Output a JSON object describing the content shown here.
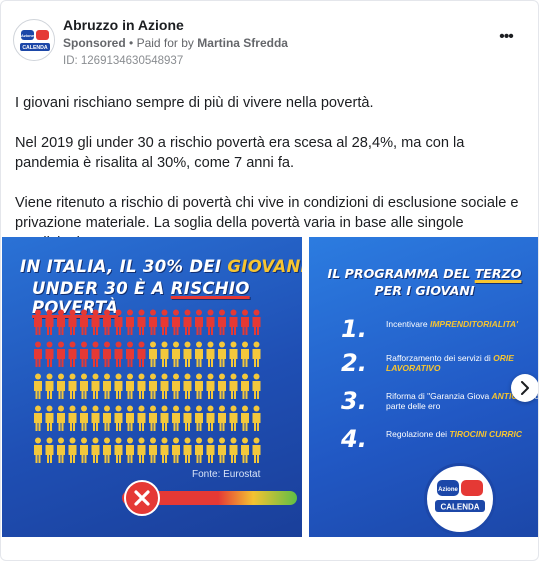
{
  "header": {
    "page_name": "Abruzzo in Azione",
    "sponsored_label": "Sponsored",
    "paid_for_prefix": "Paid for by",
    "paid_for_name": "Martina Sfredda",
    "separator": "•",
    "ad_id": "ID: 1269134630548937",
    "more_label": "•••",
    "avatar_logo_text_top": "Azione",
    "avatar_logo_text_bottom": "CALENDA"
  },
  "body": {
    "paragraph_1": "I giovani rischiano sempre di più di vivere nella povertà.",
    "paragraph_2": "Nel 2019 gli under 30 a rischio povertà era scesa al 28,4%, ma con la pandemia è risalita al 30%, come 7 anni fa.",
    "paragraph_3": "Viene ritenuto a rischio di povertà chi vive in condizioni di esclusione sociale e privazione materiale. La soglia della povertà varia in base alle singole condizioni,..."
  },
  "slide1": {
    "headline_line1_a": "IN ITALIA, IL 30% DEI ",
    "headline_line1_b": "GIOVANI",
    "headline_line2_a": "UNDER 30 È A ",
    "headline_line2_b": "RISCHIO POVERTÀ",
    "people_total": 100,
    "people_at_risk": 30,
    "color_at_risk": "#e53935",
    "color_other": "#f3c83c",
    "source": "Fonte: Eurostat"
  },
  "slide2": {
    "title_line1_a": "IL PROGRAMMA DEL ",
    "title_line1_b": "TERZO",
    "title_line2": "PER I GIOVANI",
    "items": [
      {
        "num": "1.",
        "text_a": "Incentivare ",
        "text_b": "IMPRENDITORIALITA'",
        "text_c": ""
      },
      {
        "num": "2.",
        "text_a": "Rafforzamento dei servizi di ",
        "text_b": "ORIE LAVORATIVO",
        "text_c": ""
      },
      {
        "num": "3.",
        "text_a": "Riforma di \"Garanzia Giova ",
        "text_b": "ANTICIPO",
        "text_c": " di parte delle ero"
      },
      {
        "num": "4.",
        "text_a": "Regolazione dei ",
        "text_b": "TIROCINI CURRIC",
        "text_c": ""
      }
    ],
    "logo_text_top": "Azione",
    "logo_text_bottom": "CALENDA"
  },
  "colors": {
    "brand_blue": "#1c47a8",
    "accent_yellow": "#f7c530",
    "accent_red": "#e53935"
  }
}
